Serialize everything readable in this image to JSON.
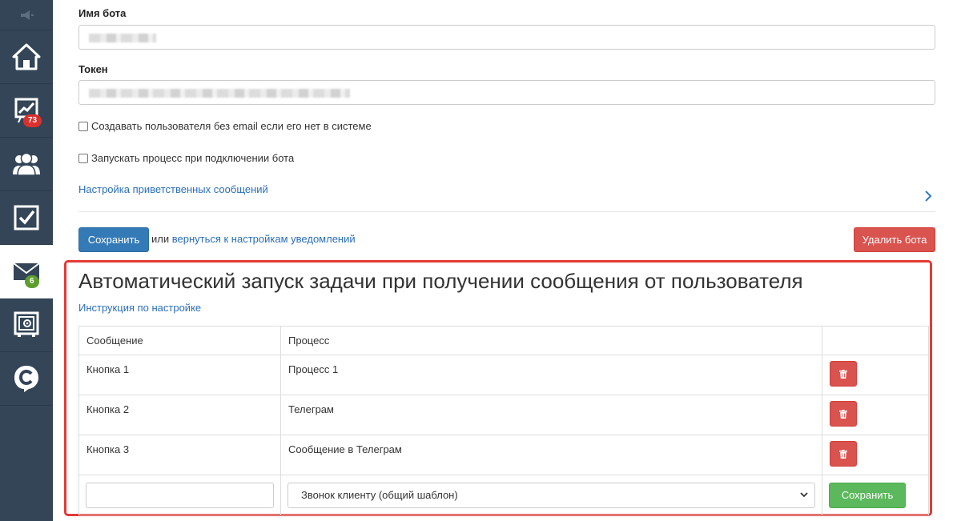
{
  "sidebar": {
    "items": [
      {
        "name": "megaphone-icon"
      },
      {
        "name": "home-icon"
      },
      {
        "name": "chart-icon",
        "badge": "73"
      },
      {
        "name": "users-icon"
      },
      {
        "name": "checkbox-icon"
      },
      {
        "name": "mail-icon",
        "badge": "6"
      },
      {
        "name": "safe-icon"
      },
      {
        "name": "chat-logo-icon"
      }
    ]
  },
  "form": {
    "bot_name_label": "Имя бота",
    "token_label": "Токен",
    "create_user_label": "Создавать пользователя без email если его нет в системе",
    "run_process_label": "Запускать процесс при подключении бота",
    "welcome_link": "Настройка приветственных сообщений",
    "save_label": "Сохранить",
    "or_text": "или",
    "back_link": "вернуться к настройкам уведомлений",
    "delete_label": "Удалить бота"
  },
  "auto": {
    "title": "Автоматический запуск задачи при получении сообщения от пользователя",
    "instruction_link": "Инструкция по настройке",
    "headers": {
      "message": "Сообщение",
      "process": "Процесс"
    },
    "rows": [
      {
        "message": "Кнопка 1",
        "process": "Процесс 1"
      },
      {
        "message": "Кнопка 2",
        "process": "Телеграм"
      },
      {
        "message": "Кнопка 3",
        "process": "Сообщение в Телеграм"
      }
    ],
    "select_value": "Звонок клиенту (общий шаблон)",
    "save_label": "Сохранить"
  },
  "colors": {
    "accent": "#337ab7",
    "danger": "#d9534f",
    "success": "#5cb85c",
    "highlight": "#e53935",
    "sidebar": "#334557"
  }
}
